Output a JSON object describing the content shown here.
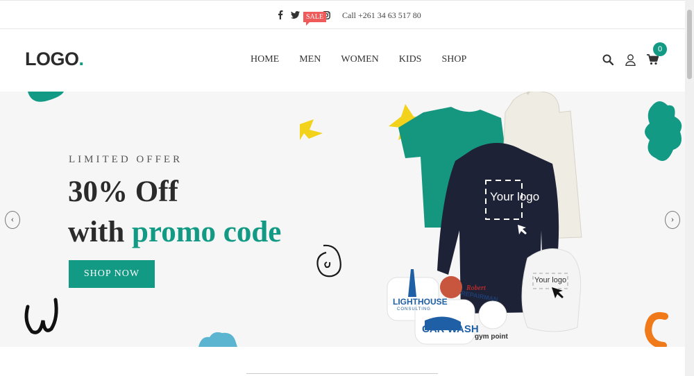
{
  "topbar": {
    "social_icons": [
      "facebook-icon",
      "twitter-icon",
      "youtube-icon",
      "instagram-icon"
    ],
    "call_text": "Call +261 34 63 517 80"
  },
  "header": {
    "logo_text": "LOGO",
    "logo_dot": ".",
    "nav": [
      "HOME",
      "MEN",
      "WOMEN",
      "KIDS",
      "SHOP"
    ],
    "sale_badge": "SALE",
    "icons": [
      "search-icon",
      "user-icon",
      "cart-icon"
    ],
    "cart_count": "0"
  },
  "hero": {
    "kicker": "LIMITED OFFER",
    "headline_1": "30% Off",
    "headline_2_prefix": "with ",
    "headline_2_accent": "promo code",
    "button": "SHOP NOW",
    "product_mockup_text": [
      "Your logo",
      "Your logo"
    ],
    "sticker_texts": [
      "LIGHTHOUSE",
      "CONSULTING",
      "CAR WASH",
      "Robert",
      "REPAIRMAN",
      "gym point"
    ],
    "prev_arrow": "‹",
    "next_arrow": "›"
  },
  "colors": {
    "accent": "#129a85",
    "sale": "#ef5b5b",
    "hero_bg": "#f6f6f6"
  }
}
